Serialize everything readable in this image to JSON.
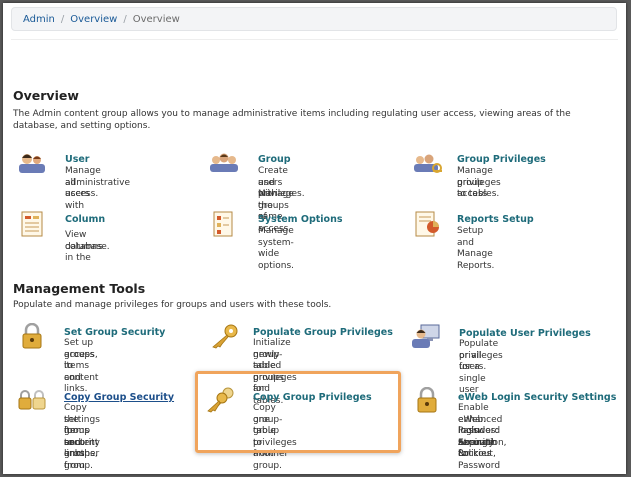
{
  "breadcrumb": [
    "Admin",
    "Overview",
    "Overview"
  ],
  "overview": {
    "title": "Overview",
    "description": "The Admin content group allows you to manage administrative items including regulating user access, viewing areas of the database, and setting options.",
    "items": [
      {
        "title": "User",
        "text": [
          "Manage all users with",
          "administrative access."
        ],
        "icon": "users-icon"
      },
      {
        "title": "Group",
        "text": [
          "Create and Manage groups of",
          "users with the same access",
          "privileges."
        ],
        "icon": "group-icon"
      },
      {
        "title": "Group Privileges",
        "text": [
          "Manage group access",
          "privileges to tables."
        ],
        "icon": "group-privileges-icon"
      },
      {
        "title": "Column",
        "text": [
          "View columns in the",
          "database."
        ],
        "icon": "column-icon"
      },
      {
        "title": "System Options",
        "text": [
          "Manage system-wide options."
        ],
        "icon": "system-options-icon"
      },
      {
        "title": "Reports Setup",
        "text": [
          "Setup and Manage Reports."
        ],
        "icon": "reports-icon"
      }
    ]
  },
  "management": {
    "title": "Management Tools",
    "description": "Populate and manage privileges for groups and users with these tools.",
    "items": [
      {
        "title": "Set Group Security",
        "text": [
          "Set up access to content",
          "groups, items and links."
        ],
        "icon": "lock-icon"
      },
      {
        "title": "Populate Group Privileges",
        "text": [
          "Initialize group-table privileges for",
          "newly added groups and tables."
        ],
        "icon": "key-icon"
      },
      {
        "title": "Populate User Privileges",
        "text": [
          "Populate privileges for a single user",
          "or all users."
        ],
        "icon": "user-computer-icon"
      },
      {
        "title": "Copy Group Security",
        "text": [
          "Copy the group security",
          "settings for content groups,",
          "items and links from one group",
          "to another group."
        ],
        "icon": "double-lock-icon"
      },
      {
        "title": "Copy Group Privileges",
        "text": [
          "Copy group-table privileges from",
          "one group to another group."
        ],
        "icon": "copy-keys-icon"
      },
      {
        "title": "eWeb Login Security Settings",
        "text": [
          "Enable enhanced login security for",
          "eWeb. Includes: Account Lockout,",
          "Password Expiration, & Password",
          "Strength Policies"
        ],
        "icon": "lock-icon"
      }
    ]
  },
  "colors": {
    "link": "#1e6b7a",
    "breadcrumb_link": "#1a5a97",
    "highlight": "#f0a45c"
  }
}
